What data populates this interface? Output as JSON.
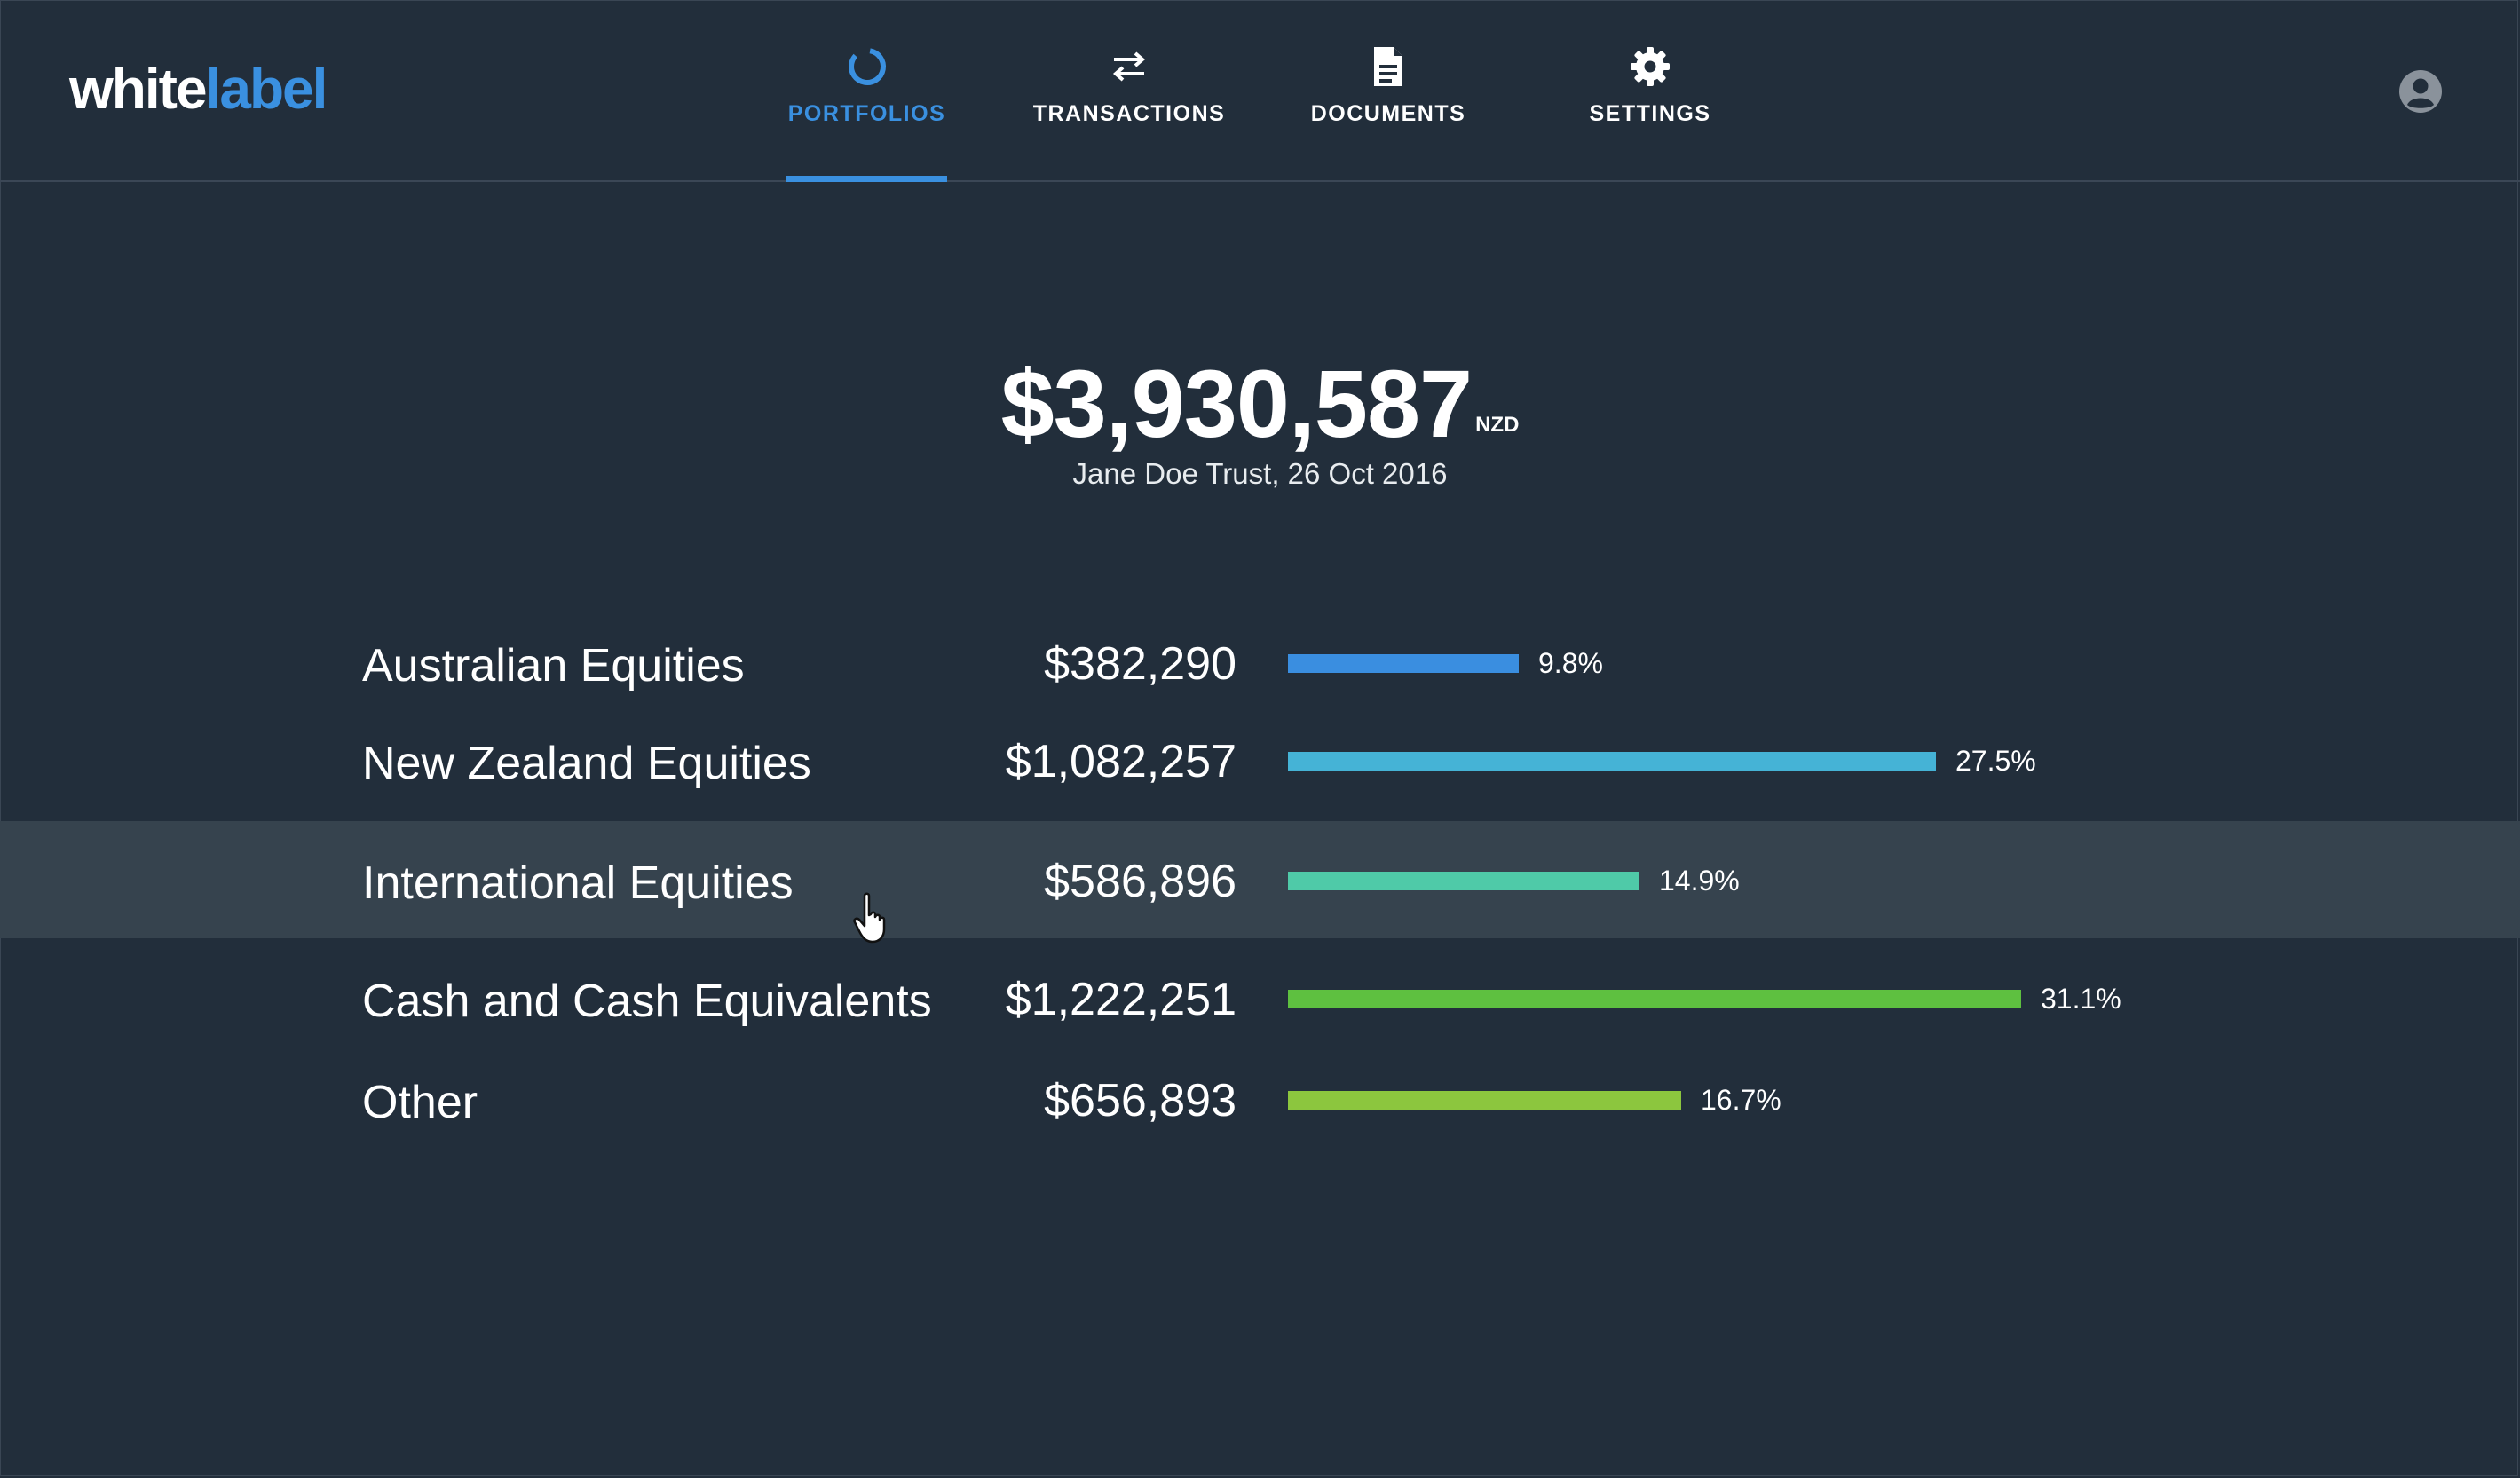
{
  "app": {
    "logo_part1": "white",
    "logo_part2": "label",
    "brand_color": "#3a90e0",
    "background": "#222e3b"
  },
  "nav": {
    "items": [
      {
        "label": "PORTFOLIOS",
        "icon": "donut-chart-icon",
        "active": true
      },
      {
        "label": "TRANSACTIONS",
        "icon": "swap-arrows-icon",
        "active": false
      },
      {
        "label": "DOCUMENTS",
        "icon": "document-icon",
        "active": false
      },
      {
        "label": "SETTINGS",
        "icon": "gear-icon",
        "active": false
      }
    ],
    "avatar_icon": "user-avatar-icon"
  },
  "summary": {
    "total": "$3,930,587",
    "currency": "NZD",
    "subtitle": "Jane Doe Trust, 26 Oct 2016"
  },
  "allocations": [
    {
      "name": "Australian Equities",
      "value": "$382,290",
      "percent": "9.8%",
      "fraction": 0.098,
      "color": "#3a8ee0"
    },
    {
      "name": "New Zealand Equities",
      "value": "$1,082,257",
      "percent": "27.5%",
      "fraction": 0.275,
      "color": "#45b3d6"
    },
    {
      "name": "International Equities",
      "value": "$586,896",
      "percent": "14.9%",
      "fraction": 0.149,
      "color": "#4fcaa8",
      "highlighted": true
    },
    {
      "name": "Cash and Cash Equivalents",
      "value": "$1,222,251",
      "percent": "31.1%",
      "fraction": 0.311,
      "color": "#5ec040"
    },
    {
      "name": "Other",
      "value": "$656,893",
      "percent": "16.7%",
      "fraction": 0.167,
      "color": "#8cc63e"
    }
  ]
}
